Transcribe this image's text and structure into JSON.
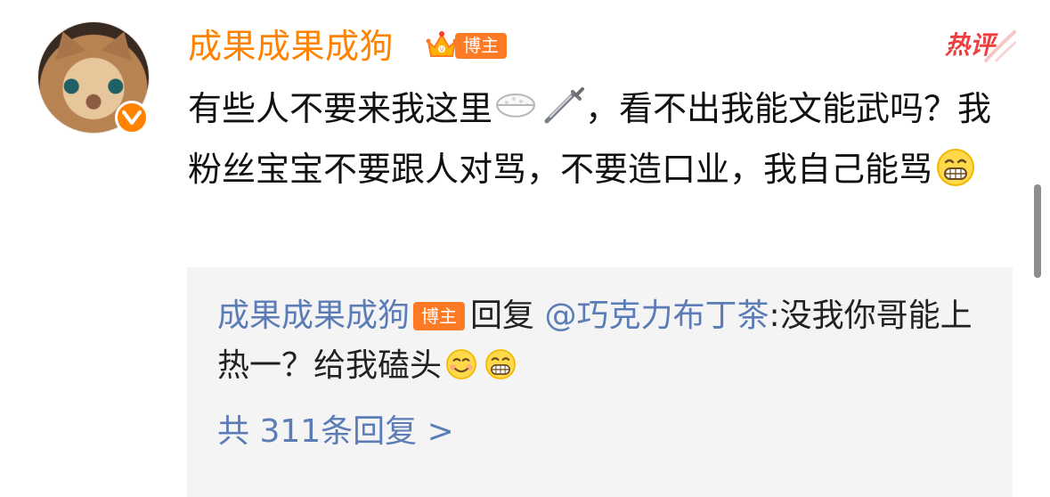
{
  "post": {
    "username": "成果成果成狗",
    "badge_label": "博主",
    "hot_label": "热评",
    "comment_text_1": "有些人不要来我这里",
    "comment_text_2": "，看不出我能文能武吗？我粉丝宝宝不要跟人对骂，不要造口业，我自己能骂",
    "icons": {
      "rice": "rice-bowl-icon",
      "sword": "sword-icon",
      "grin": "grinning-face-icon",
      "smile": "smiling-face-icon",
      "crown": "crown-icon",
      "verified": "verified-icon"
    }
  },
  "reply": {
    "username": "成果成果成狗",
    "badge_label": "博主",
    "reply_word": "回复",
    "target": "@巧克力布丁茶",
    "text": ":没我你哥能上热一？给我磕头",
    "count_label": "共 311条回复 >"
  },
  "colors": {
    "accent_orange": "#ff8200",
    "link_blue": "#5b7cb7",
    "hot_red": "#ec3f3f",
    "reply_bg": "#f4f4f4"
  }
}
